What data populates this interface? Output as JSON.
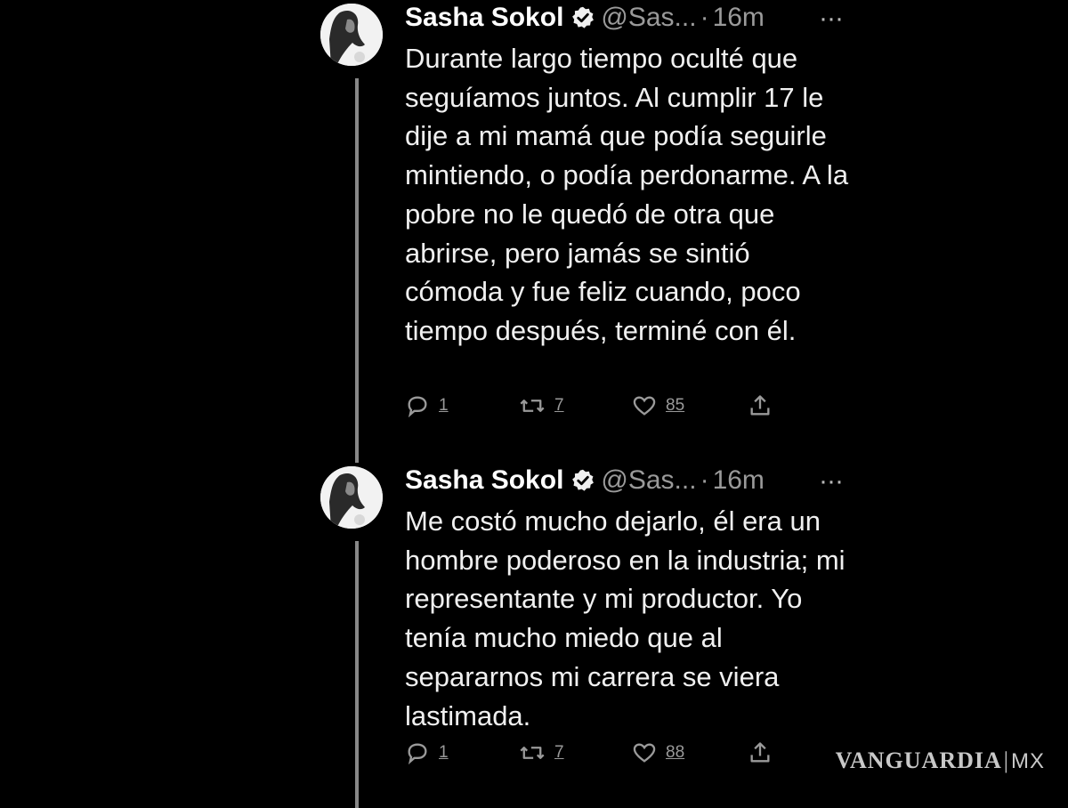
{
  "tweets": [
    {
      "author_name": "Sasha Sokol",
      "handle": "@Sas...",
      "separator": "·",
      "time": "16m",
      "more_label": "···",
      "body": "Durante largo tiempo oculté que seguíamos juntos. Al cumplir 17 le dije a mi mamá que podía seguirle mintiendo, o podía perdonarme. A la pobre no le quedó de otra que abrirse, pero jamás se sintió cómoda y fue feliz cuando, poco tiempo después, terminé con él.",
      "reply_count": "1",
      "retweet_count": "7",
      "like_count": "85"
    },
    {
      "author_name": "Sasha Sokol",
      "handle": "@Sas...",
      "separator": "·",
      "time": "16m",
      "more_label": "···",
      "body": "Me costó mucho dejarlo, él era un hombre poderoso en la industria; mi representante y mi productor. Yo tenía mucho miedo que al separarnos mi carrera se viera lastimada.",
      "reply_count": "1",
      "retweet_count": "7",
      "like_count": "88"
    }
  ],
  "watermark": {
    "brand": "VANGUARDIA",
    "separator": "|",
    "suffix": "MX"
  },
  "icons": {
    "verified": "verified-badge-icon",
    "reply": "reply-icon",
    "retweet": "retweet-icon",
    "like": "heart-icon",
    "share": "share-icon"
  }
}
